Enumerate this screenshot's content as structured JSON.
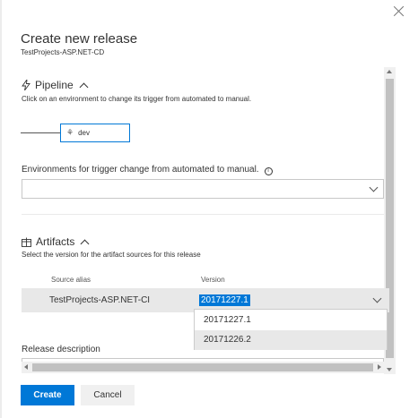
{
  "dialog": {
    "title": "Create new release",
    "subtitle": "TestProjects-ASP.NET-CD"
  },
  "pipeline": {
    "heading": "Pipeline",
    "hint": "Click on an environment to change its trigger from automated to manual.",
    "environment": "dev"
  },
  "trigger_change": {
    "label": "Environments for trigger change from automated to manual.",
    "value": ""
  },
  "artifacts": {
    "heading": "Artifacts",
    "hint": "Select the version for the artifact sources for this release",
    "columns": [
      "Source alias",
      "Version"
    ],
    "rows": [
      {
        "source_alias": "TestProjects-ASP.NET-CI",
        "version": "20171227.1"
      }
    ],
    "version_options": [
      "20171227.1",
      "20171226.2"
    ],
    "highlighted_option": "20171226.2"
  },
  "release_description": {
    "label": "Release description"
  },
  "actions": {
    "create": "Create",
    "cancel": "Cancel"
  },
  "colors": {
    "accent": "#0078d7",
    "row_bg": "#e8e8e8"
  }
}
